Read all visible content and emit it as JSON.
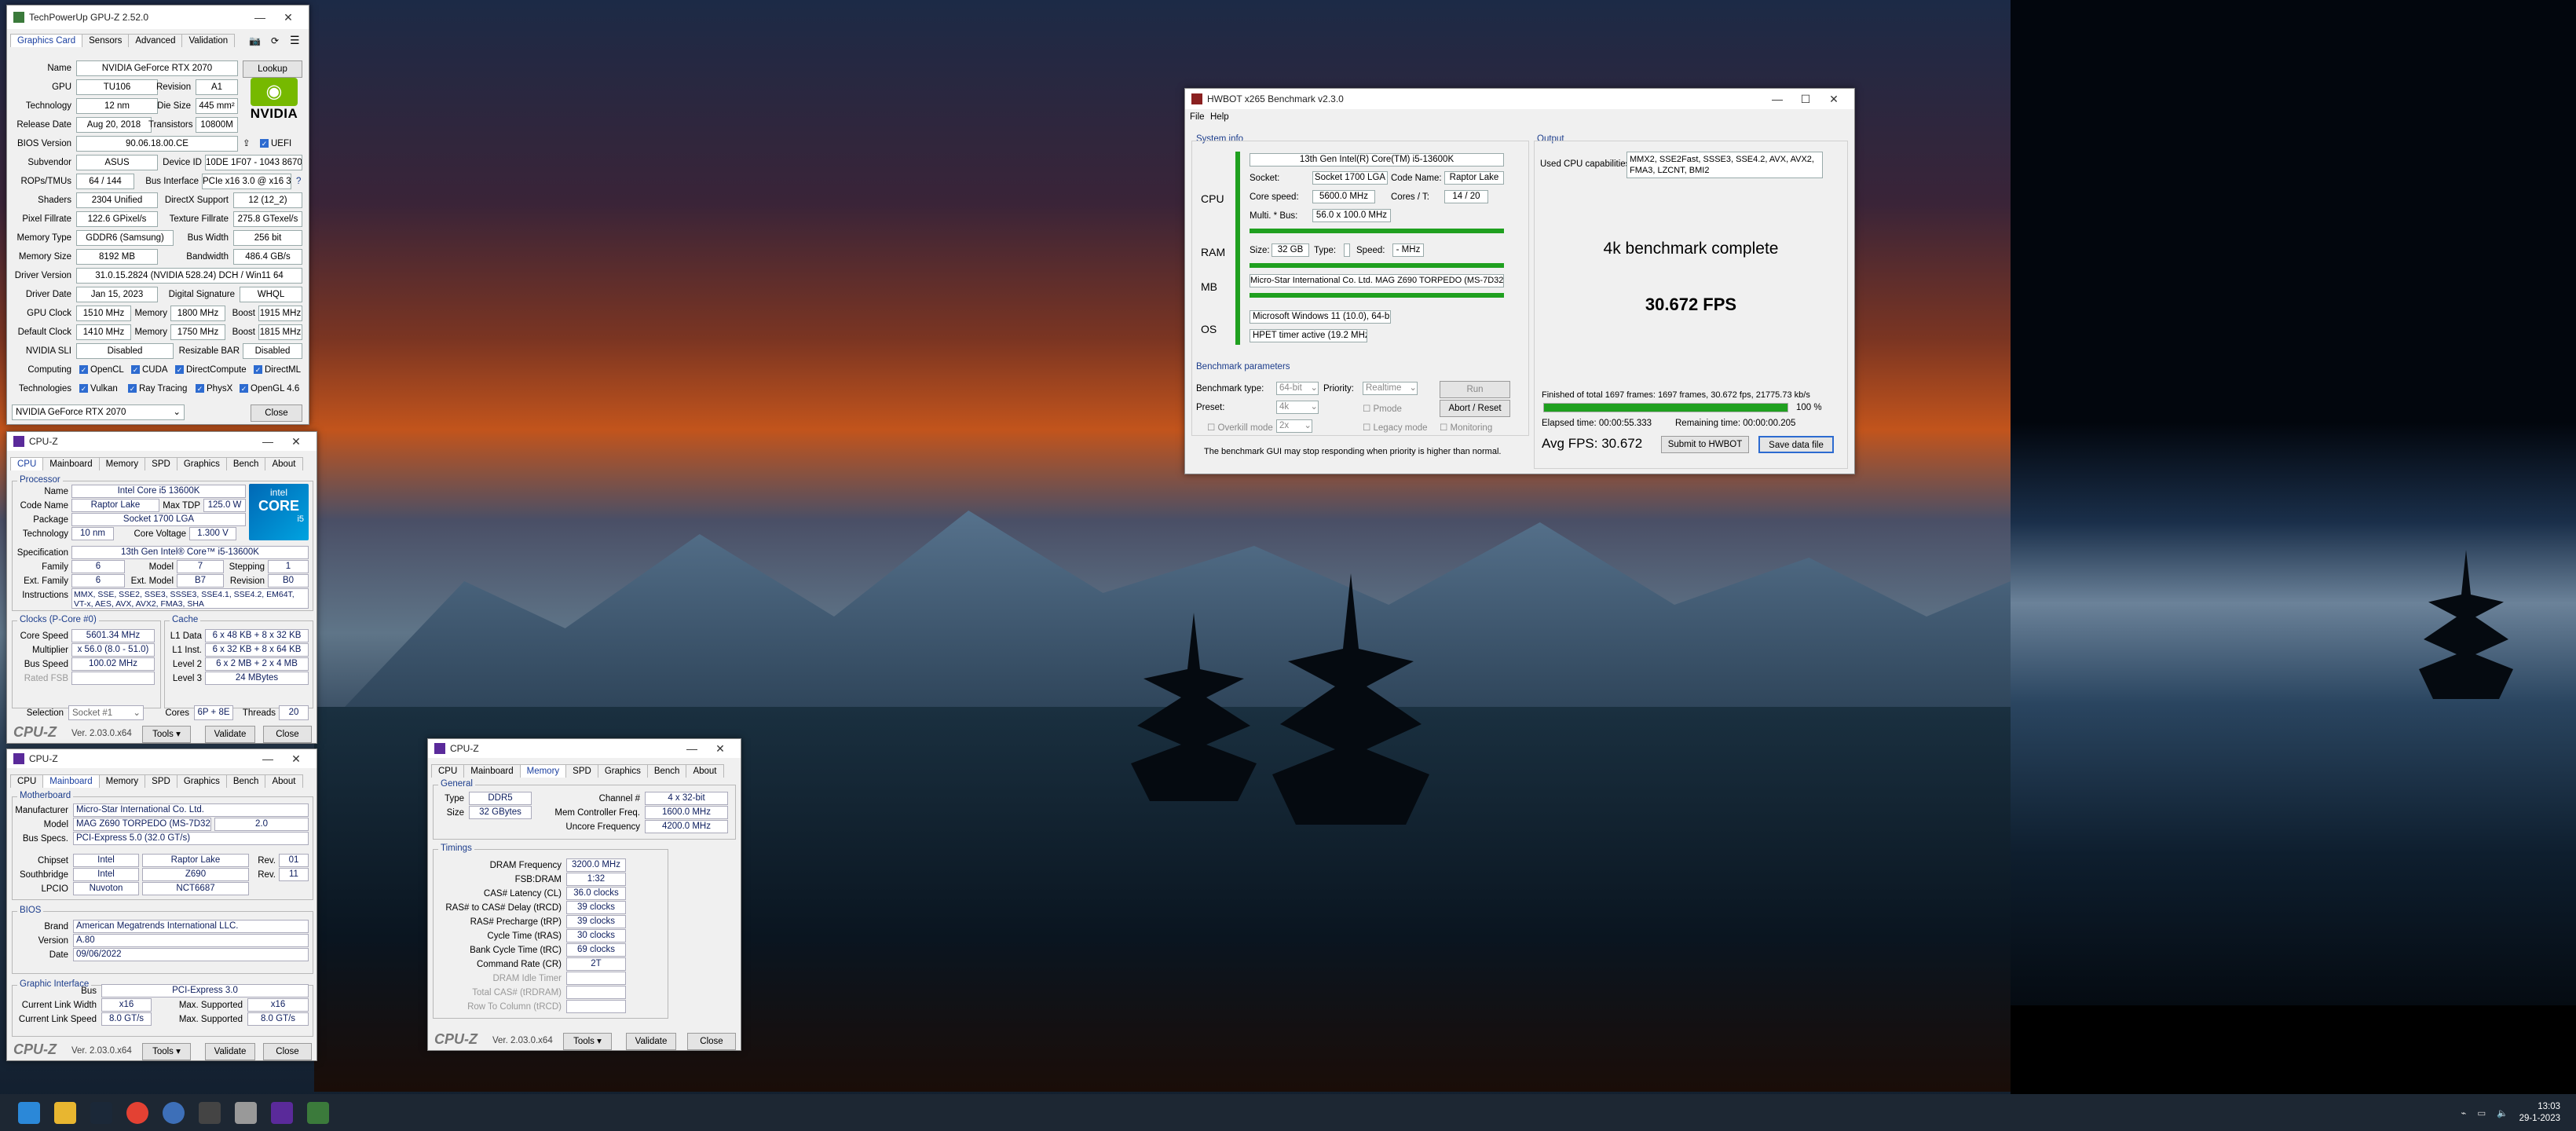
{
  "gpuz": {
    "title": "TechPowerUp GPU-Z 2.52.0",
    "tabs": [
      "Graphics Card",
      "Sensors",
      "Advanced",
      "Validation"
    ],
    "lookup": "Lookup",
    "name_l": "Name",
    "name": "NVIDIA GeForce RTX 2070",
    "gpu_l": "GPU",
    "gpu": "TU106",
    "rev_l": "Revision",
    "rev": "A1",
    "tech_l": "Technology",
    "tech": "12 nm",
    "die_l": "Die Size",
    "die": "445 mm²",
    "rel_l": "Release Date",
    "rel": "Aug 20, 2018",
    "trans_l": "Transistors",
    "trans": "10800M",
    "bios_l": "BIOS Version",
    "bios": "90.06.18.00.CE",
    "uefi": "UEFI",
    "sub_l": "Subvendor",
    "sub": "ASUS",
    "devid_l": "Device ID",
    "devid": "10DE 1F07 - 1043 8670",
    "rops_l": "ROPs/TMUs",
    "rops": "64 / 144",
    "bus_l": "Bus Interface",
    "bus": "PCIe x16 3.0 @ x16 3.0",
    "q": "?",
    "shad_l": "Shaders",
    "shad": "2304 Unified",
    "dx_l": "DirectX Support",
    "dx": "12 (12_2)",
    "pix_l": "Pixel Fillrate",
    "pix": "122.6 GPixel/s",
    "tex_l": "Texture Fillrate",
    "tex": "275.8 GTexel/s",
    "mt_l": "Memory Type",
    "mt": "GDDR6 (Samsung)",
    "bw_l": "Bus Width",
    "bw": "256 bit",
    "ms_l": "Memory Size",
    "ms": "8192 MB",
    "band_l": "Bandwidth",
    "band": "486.4 GB/s",
    "drv_l": "Driver Version",
    "drv": "31.0.15.2824 (NVIDIA 528.24) DCH / Win11 64",
    "dd_l": "Driver Date",
    "dd": "Jan 15, 2023",
    "sig_l": "Digital Signature",
    "sig": "WHQL",
    "gc_l": "GPU Clock",
    "gc": "1510 MHz",
    "mem_l": "Memory",
    "gcm": "1800 MHz",
    "boost_l": "Boost",
    "gcb": "1915 MHz",
    "dc_l": "Default Clock",
    "dc": "1410 MHz",
    "dcm": "1750 MHz",
    "dcb": "1815 MHz",
    "sli_l": "NVIDIA SLI",
    "sli": "Disabled",
    "rbar_l": "Resizable BAR",
    "rbar": "Disabled",
    "comp_l": "Computing",
    "comp": [
      "OpenCL",
      "CUDA",
      "DirectCompute",
      "DirectML"
    ],
    "techs_l": "Technologies",
    "techs": [
      "Vulkan",
      "Ray Tracing",
      "PhysX",
      "OpenGL 4.6"
    ],
    "sel": "NVIDIA GeForce RTX 2070",
    "close": "Close",
    "vendor": "NVIDIA"
  },
  "cpuz1": {
    "title": "CPU-Z",
    "tabs": [
      "CPU",
      "Mainboard",
      "Memory",
      "SPD",
      "Graphics",
      "Bench",
      "About"
    ],
    "proc": "Processor",
    "name_l": "Name",
    "name": "Intel Core i5 13600K",
    "code_l": "Code Name",
    "code": "Raptor Lake",
    "tdp_l": "Max TDP",
    "tdp": "125.0 W",
    "pkg_l": "Package",
    "pkg": "Socket 1700 LGA",
    "tech_l": "Technology",
    "tech": "10 nm",
    "cv_l": "Core Voltage",
    "cv": "1.300 V",
    "spec_l": "Specification",
    "spec": "13th Gen Intel® Core™ i5-13600K",
    "fam_l": "Family",
    "fam": "6",
    "mod_l": "Model",
    "mod": "7",
    "step_l": "Stepping",
    "step": "1",
    "efam_l": "Ext. Family",
    "efam": "6",
    "emod_l": "Ext. Model",
    "emod": "B7",
    "rev_l": "Revision",
    "rev": "B0",
    "ins_l": "Instructions",
    "ins": "MMX, SSE, SSE2, SSE3, SSSE3, SSE4.1, SSE4.2, EM64T, VT-x, AES, AVX, AVX2, FMA3, SHA",
    "clk": "Clocks (P-Core #0)",
    "cache": "Cache",
    "cs_l": "Core Speed",
    "cs": "5601.34 MHz",
    "l1d_l": "L1 Data",
    "l1d": "6 x 48 KB + 8 x 32 KB",
    "mul_l": "Multiplier",
    "mul": "x 56.0 (8.0 - 51.0)",
    "l1i_l": "L1 Inst.",
    "l1i": "6 x 32 KB + 8 x 64 KB",
    "bs_l": "Bus Speed",
    "bs": "100.02 MHz",
    "l2_l": "Level 2",
    "l2": "6 x 2 MB + 2 x 4 MB",
    "fsb_l": "Rated FSB",
    "l3_l": "Level 3",
    "l3": "24 MBytes",
    "sel_l": "Selection",
    "sel": "Socket #1",
    "cores_l": "Cores",
    "cores": "6P + 8E",
    "thr_l": "Threads",
    "thr": "20",
    "logo": "CPU-Z",
    "ver": "Ver. 2.03.0.x64",
    "tools": "Tools",
    "validate": "Validate",
    "close": "Close",
    "intel": "intel",
    "core": "CORE",
    "i5": "i5"
  },
  "cpuz2": {
    "title": "CPU-Z",
    "tabs": [
      "CPU",
      "Mainboard",
      "Memory",
      "SPD",
      "Graphics",
      "Bench",
      "About"
    ],
    "mb": "Motherboard",
    "man_l": "Manufacturer",
    "man": "Micro-Star International Co. Ltd.",
    "mod_l": "Model",
    "mod": "MAG Z690 TORPEDO (MS-7D32)",
    "modv": "2.0",
    "bus_l": "Bus Specs.",
    "bus": "PCI-Express 5.0 (32.0 GT/s)",
    "chip_l": "Chipset",
    "chip": "Intel",
    "chip2": "Raptor Lake",
    "rev_l": "Rev.",
    "chipr": "01",
    "sb_l": "Southbridge",
    "sb": "Intel",
    "sb2": "Z690",
    "sbr": "11",
    "lpc_l": "LPCIO",
    "lpc": "Nuvoton",
    "lpc2": "NCT6687",
    "bios": "BIOS",
    "br_l": "Brand",
    "br": "American Megatrends International LLC.",
    "bv_l": "Version",
    "bv": "A.80",
    "bd_l": "Date",
    "bd": "09/06/2022",
    "gi": "Graphic Interface",
    "gb_l": "Bus",
    "gb": "PCI-Express 3.0",
    "lw_l": "Current Link Width",
    "lw": "x16",
    "mw_l": "Max. Supported",
    "mw": "x16",
    "ls_l": "Current Link Speed",
    "ls": "8.0 GT/s",
    "ms": "8.0 GT/s",
    "logo": "CPU-Z",
    "ver": "Ver. 2.03.0.x64",
    "tools": "Tools",
    "validate": "Validate",
    "close": "Close"
  },
  "cpuz3": {
    "title": "CPU-Z",
    "tabs": [
      "CPU",
      "Mainboard",
      "Memory",
      "SPD",
      "Graphics",
      "Bench",
      "About"
    ],
    "gen": "General",
    "type_l": "Type",
    "type": "DDR5",
    "ch_l": "Channel #",
    "ch": "4 x 32-bit",
    "size_l": "Size",
    "size": "32 GBytes",
    "mcf_l": "Mem Controller Freq.",
    "mcf": "1600.0 MHz",
    "unc_l": "Uncore Frequency",
    "unc": "4200.0 MHz",
    "tim": "Timings",
    "rows": [
      {
        "l": "DRAM Frequency",
        "v": "3200.0 MHz"
      },
      {
        "l": "FSB:DRAM",
        "v": "1:32"
      },
      {
        "l": "CAS# Latency (CL)",
        "v": "36.0 clocks"
      },
      {
        "l": "RAS# to CAS# Delay (tRCD)",
        "v": "39 clocks"
      },
      {
        "l": "RAS# Precharge (tRP)",
        "v": "39 clocks"
      },
      {
        "l": "Cycle Time (tRAS)",
        "v": "30 clocks"
      },
      {
        "l": "Bank Cycle Time (tRC)",
        "v": "69 clocks"
      },
      {
        "l": "Command Rate (CR)",
        "v": "2T"
      },
      {
        "l": "DRAM Idle Timer",
        "v": ""
      },
      {
        "l": "Total CAS# (tRDRAM)",
        "v": ""
      },
      {
        "l": "Row To Column (tRCD)",
        "v": ""
      }
    ],
    "logo": "CPU-Z",
    "ver": "Ver. 2.03.0.x64",
    "tools": "Tools",
    "validate": "Validate",
    "close": "Close"
  },
  "hwbot": {
    "title": "HWBOT x265 Benchmark v2.3.0",
    "menu": [
      "File",
      "Help"
    ],
    "sys": "System info",
    "out": "Output",
    "cpu": "CPU",
    "ram": "RAM",
    "mb": "MB",
    "os": "OS",
    "cpuname": "13th Gen Intel(R) Core(TM) i5-13600K",
    "sock_l": "Socket:",
    "sock": "Socket 1700 LGA",
    "cn_l": "Code Name:",
    "cn": "Raptor Lake",
    "csp_l": "Core speed:",
    "csp": "5600.0 MHz",
    "ct_l": "Cores / T:",
    "ct": "14 / 20",
    "mb_l": "Multi. * Bus:",
    "mbv": "56.0 x 100.0 MHz",
    "rsz_l": "Size:",
    "rsz": "32 GB",
    "rty_l": "Type:",
    "rsp_l": "Speed:",
    "rsp": "- MHz",
    "mbname": "Micro-Star International Co. Ltd. MAG Z690 TORPEDO (MS-7D32)",
    "osname": "Microsoft Windows 11 (10.0), 64-bit",
    "hpet": "HPET timer active (19.2 MHz)",
    "caps_l": "Used CPU capabilities:",
    "caps": "MMX2, SSE2Fast, SSSE3, SSE4.2, AVX, AVX2, FMA3, LZCNT, BMI2",
    "status": "4k benchmark complete",
    "fps": "30.672 FPS",
    "bp": "Benchmark parameters",
    "bt_l": "Benchmark type:",
    "bt": "64-bit",
    "pr_l": "Priority:",
    "pr": "Realtime",
    "run": "Run",
    "ps_l": "Preset:",
    "ps": "4k",
    "pmode": "Pmode",
    "abort": "Abort / Reset",
    "ocm": "Overkill mode",
    "ocv": "2x",
    "legacy": "Legacy mode",
    "mon": "Monitoring",
    "warn": "The benchmark GUI may stop responding when priority is higher than normal.",
    "fin": "Finished of total 1697 frames: 1697 frames, 30.672 fps,  21775.73 kb/s",
    "pct": "100 %",
    "progress": 1.0,
    "el": "Elapsed time: 00:00:55.333",
    "rem": "Remaining time: 00:00:00.205",
    "avg": "Avg FPS: 30.672",
    "submit": "Submit to HWBOT",
    "save": "Save data file"
  },
  "tray": {
    "time": "13:03",
    "date": "29-1-2023"
  }
}
